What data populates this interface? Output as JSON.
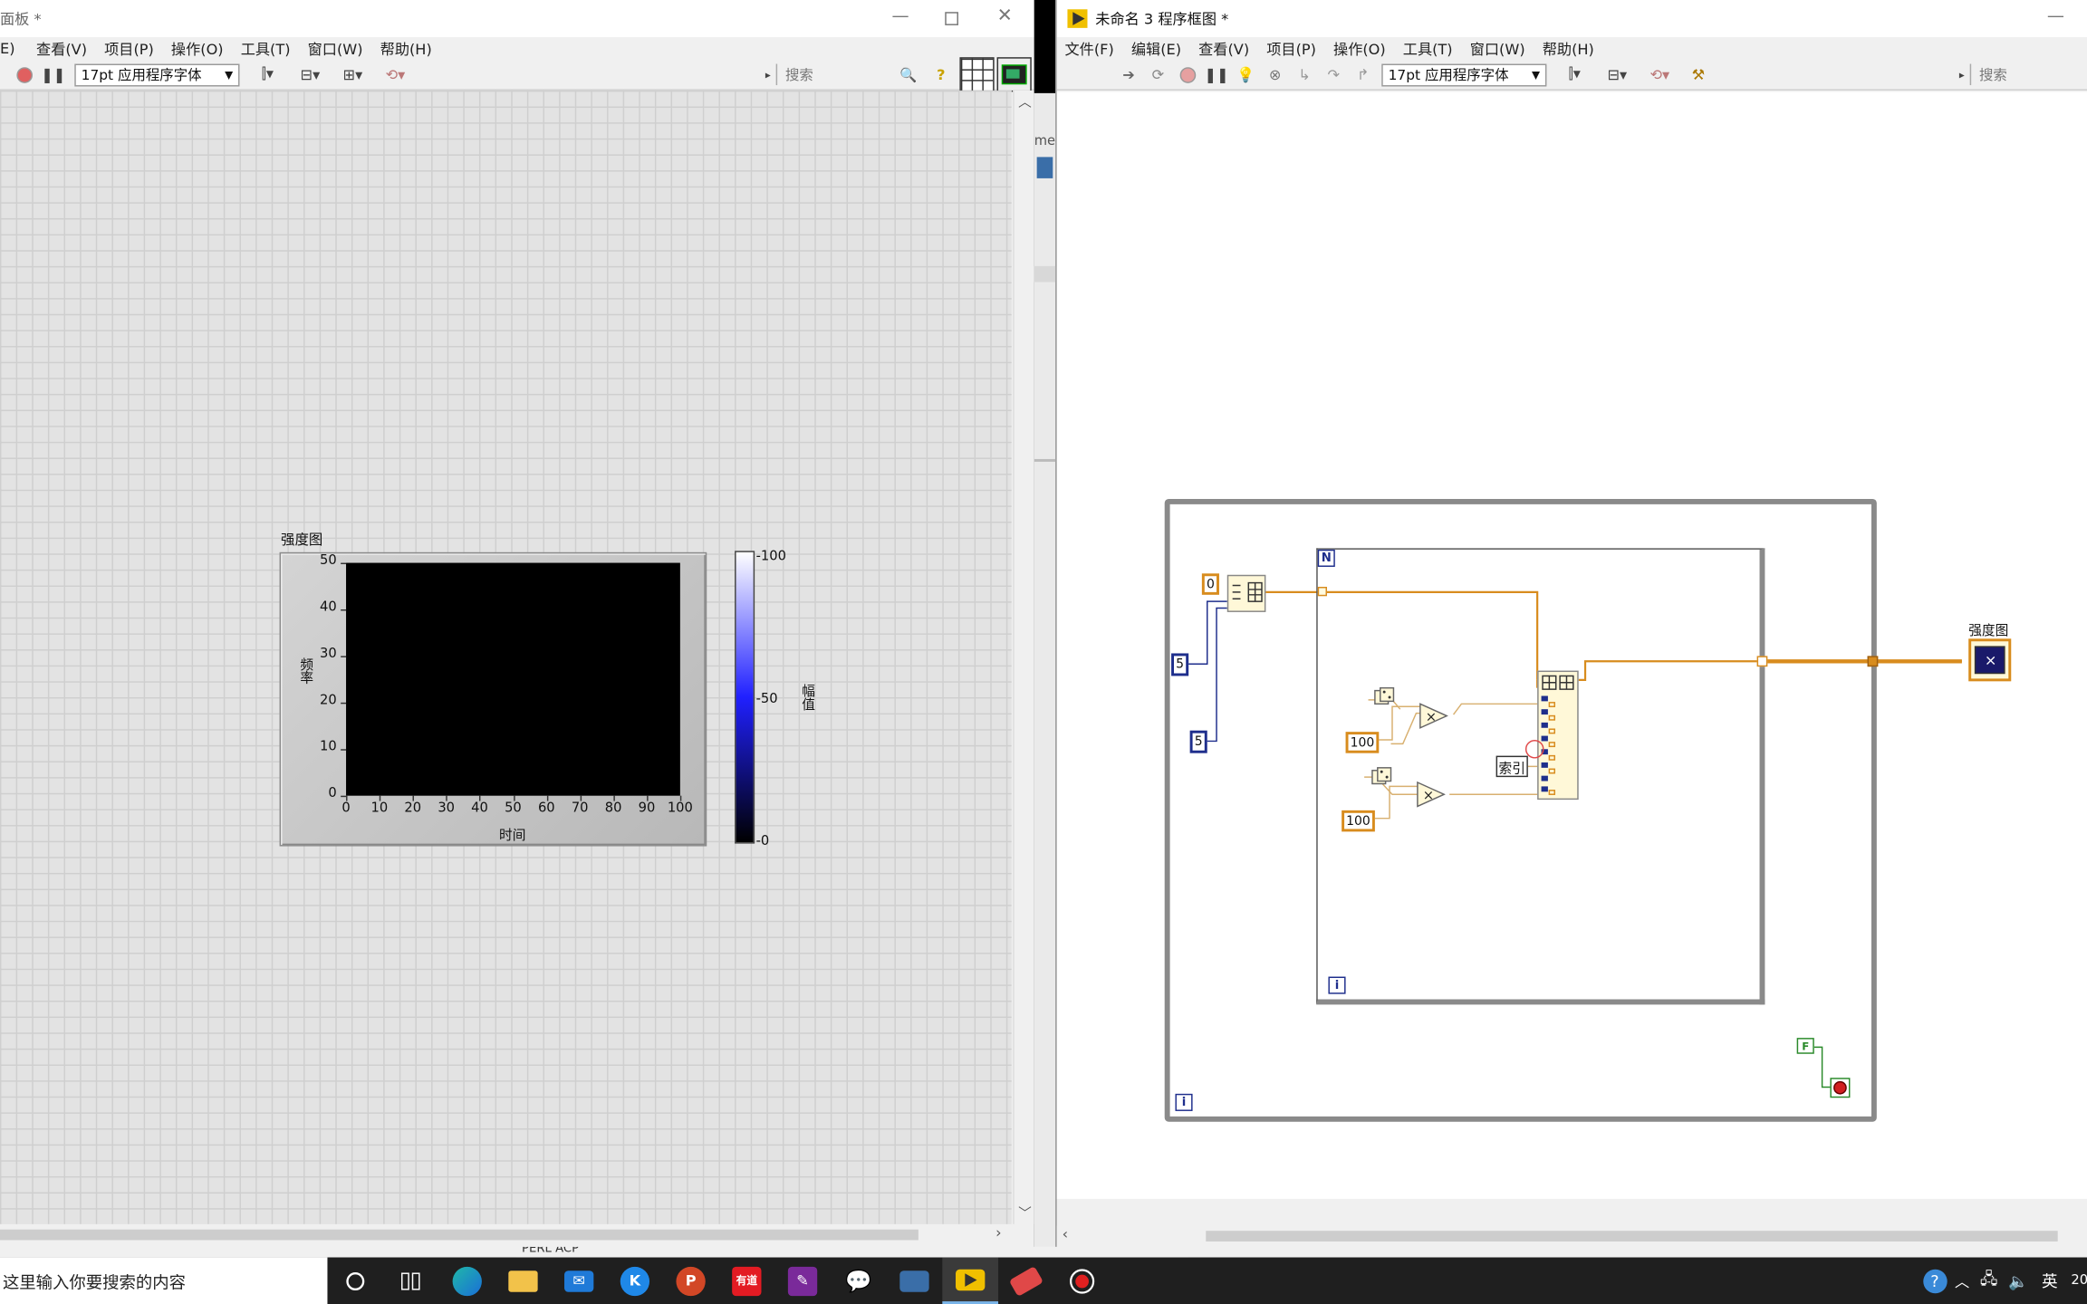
{
  "front_panel": {
    "title": "面板 *",
    "menu": [
      "E)",
      "查看(V)",
      "项目(P)",
      "操作(O)",
      "工具(T)",
      "窗口(W)",
      "帮助(H)"
    ],
    "font": "17pt 应用程序字体",
    "search_placeholder": "搜索",
    "chart": {
      "label": "强度图",
      "x_axis_label": "时间",
      "y_axis_label": "频率",
      "x_ticks": [
        "0",
        "10",
        "20",
        "30",
        "40",
        "50",
        "60",
        "70",
        "80",
        "90",
        "100"
      ],
      "y_ticks": [
        "50",
        "40",
        "30",
        "20",
        "10",
        "0"
      ],
      "colorbar_label": "幅值",
      "colorbar_ticks": [
        "100",
        "50",
        "0"
      ]
    }
  },
  "block_diagram": {
    "title": "未命名 3 程序框图 *",
    "menu": [
      "文件(F)",
      "编辑(E)",
      "查看(V)",
      "项目(P)",
      "操作(O)",
      "工具(T)",
      "窗口(W)",
      "帮助(H)"
    ],
    "font": "17pt 应用程序字体",
    "search_placeholder": "搜索",
    "constants": {
      "zero": "0",
      "five_a": "5",
      "five_b": "5",
      "hundred_a": "100",
      "hundred_b": "100",
      "false_const": "F"
    },
    "for_loop_count": "N",
    "loop_iter": "i",
    "while_iter": "i",
    "index_label": "索引",
    "indicator_label": "强度图"
  },
  "background_fragments": {
    "partial_text": "me",
    "bottom_text": "PERL ACP"
  },
  "taskbar": {
    "search_placeholder": "这里输入你要搜索的内容",
    "ime": "英",
    "clock_fragment": "20"
  },
  "colors": {
    "wire_orange": "#d88c1e",
    "wire_blue": "#1e2e8c",
    "wire_green": "#2a8a2a",
    "colorbar_top": "#ffffff",
    "colorbar_bottom": "#000000"
  }
}
